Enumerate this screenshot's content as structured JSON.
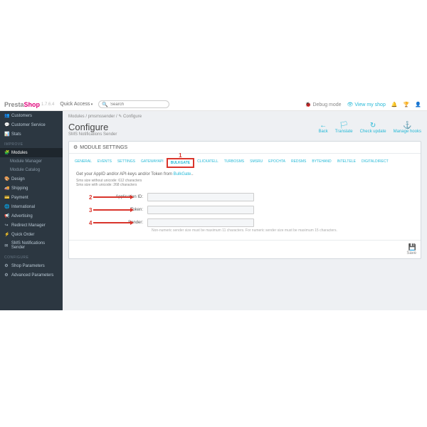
{
  "logo": {
    "pre": "Presta",
    "shop": "Shop",
    "version": "1.7.6.4"
  },
  "quick_access": "Quick Access",
  "search": {
    "placeholder": "Search"
  },
  "topright": {
    "debug": "Debug mode",
    "view": "View my shop"
  },
  "sidebar": {
    "sell_items": [
      {
        "icon": "👥",
        "label": "Customers"
      },
      {
        "icon": "💬",
        "label": "Customer Service"
      },
      {
        "icon": "📊",
        "label": "Stats"
      }
    ],
    "improve_title": "IMPROVE",
    "improve_items": [
      {
        "icon": "🧩",
        "label": "Modules",
        "active": true
      },
      {
        "sub": true,
        "label": "Module Manager"
      },
      {
        "sub": true,
        "label": "Module Catalog"
      },
      {
        "icon": "🎨",
        "label": "Design"
      },
      {
        "icon": "🚚",
        "label": "Shipping"
      },
      {
        "icon": "💳",
        "label": "Payment"
      },
      {
        "icon": "🌐",
        "label": "International"
      },
      {
        "icon": "📢",
        "label": "Advertising"
      },
      {
        "icon": "↪",
        "label": "Redirect Manager"
      },
      {
        "icon": "⚡",
        "label": "Quick Order"
      },
      {
        "icon": "✉",
        "label": "SMS Notifications Sender"
      }
    ],
    "configure_title": "CONFIGURE",
    "configure_items": [
      {
        "icon": "⚙",
        "label": "Shop Parameters"
      },
      {
        "icon": "⚙",
        "label": "Advanced Parameters"
      }
    ]
  },
  "breadcrumb": "Modules  /  pmsmssender  /  ✎ Configure",
  "page": {
    "title": "Configure",
    "subtitle": "SMS Notifications Sender"
  },
  "actions": [
    {
      "icon": "←",
      "label": "Back"
    },
    {
      "icon": "🏳",
      "label": "Translate"
    },
    {
      "icon": "↻",
      "label": "Check update"
    },
    {
      "icon": "⚓",
      "label": "Manage hooks"
    }
  ],
  "panel": {
    "title": "MODULE SETTINGS"
  },
  "tabs": [
    "GENERAL",
    "EVENTS",
    "SETTINGS",
    "GATEWAYAPI",
    "BULKGATE",
    "CLICKATELL",
    "TURBOSMS",
    "SMSRU",
    "EPOCHTA",
    "REDSMS",
    "BYTEHAND",
    "INTELTELE",
    "DIGITALDIRECT"
  ],
  "active_tab_index": 4,
  "form": {
    "help1": "Get your AppID and/or API-keys and/or Token from ",
    "help_link": "BulkGate",
    "sms1": "Sms size without unicode: 612 characters",
    "sms2": "Sms size with unicode: 268 characters",
    "fields": [
      {
        "label": "Application ID:",
        "callout": "2"
      },
      {
        "label": "Token:",
        "callout": "3"
      },
      {
        "label": "Sender:",
        "callout": "4",
        "hint": "Non-numeric sender size must be maximum 11 characters. For numeric sender size must be maximum 15 characters."
      }
    ],
    "callout1": "1",
    "save": "Save"
  }
}
